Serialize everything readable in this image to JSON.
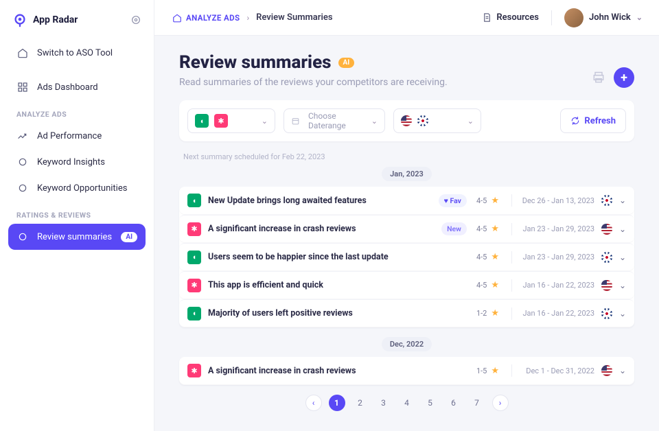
{
  "brand": {
    "name": "App Radar"
  },
  "sidebar": {
    "switch": "Switch to ASO Tool",
    "dashboard": "Ads Dashboard",
    "section_analyze": "ANALYZE ADS",
    "perf": "Ad Performance",
    "kw_insights": "Keyword Insights",
    "kw_opps": "Keyword Opportunities",
    "section_ratings": "RATINGS & REVIEWS",
    "review_summaries": "Review summaries",
    "ai_badge": "AI"
  },
  "topbar": {
    "root": "ANALYZE ADS",
    "current": "Review Summaries",
    "resources": "Resources",
    "user": "John Wick"
  },
  "header": {
    "title": "Review summaries",
    "ai_badge": "AI",
    "subtitle": "Read summaries of the reviews your competitors are receiving."
  },
  "toolbar": {
    "daterange_placeholder": "Choose Daterange",
    "refresh": "Refresh"
  },
  "schedule_note": "Next summary scheduled for Feb 22, 2023",
  "badges": {
    "fav": "Fav",
    "new": "New"
  },
  "summary_groups": [
    {
      "month": "Jan, 2023",
      "items": [
        {
          "app": "green",
          "title": "New Update brings long awaited features",
          "badge": "fav",
          "rating": "4-5",
          "date": "Dec 26 - Jan 13, 2023",
          "flag": "uk"
        },
        {
          "app": "pink",
          "title": "A significant increase in crash reviews",
          "badge": "new",
          "rating": "4-5",
          "date": "Jan 23 - Jan 29, 2023",
          "flag": "us"
        },
        {
          "app": "green",
          "title": "Users seem to be happier since the last update",
          "badge": "",
          "rating": "4-5",
          "date": "Jan 23 - Jan 29, 2023",
          "flag": "uk"
        },
        {
          "app": "pink",
          "title": "This app is efficient and quick",
          "badge": "",
          "rating": "4-5",
          "date": "Jan 16 - Jan 22, 2023",
          "flag": "us"
        },
        {
          "app": "green",
          "title": "Majority of users left positive reviews",
          "badge": "",
          "rating": "1-2",
          "date": "Jan 16 - Jan 22, 2023",
          "flag": "uk"
        }
      ]
    },
    {
      "month": "Dec, 2022",
      "items": [
        {
          "app": "pink",
          "title": "A significant increase in crash reviews",
          "badge": "",
          "rating": "1-5",
          "date": "Dec 1 - Dec  31, 2022",
          "flag": "us"
        }
      ]
    }
  ],
  "pager": {
    "pages": [
      "1",
      "2",
      "3",
      "4",
      "5",
      "6",
      "7"
    ],
    "active": 0
  }
}
